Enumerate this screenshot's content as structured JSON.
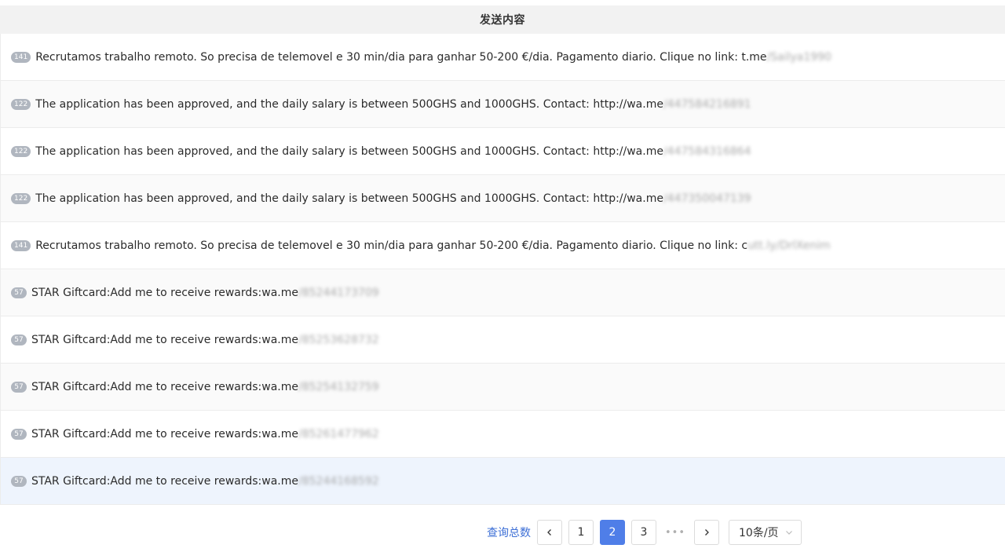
{
  "table": {
    "header": "发送内容",
    "rows": [
      {
        "badge": "141",
        "text": "Recrutamos trabalho remoto. So precisa de telemovel e 30 min/dia para ganhar 50-200 €/dia. Pagamento diario. Clique no link: t.me",
        "masked": "/Sailya1990"
      },
      {
        "badge": "122",
        "text": "The application has been approved, and the daily salary is between 500GHS and 1000GHS. Contact: http://wa.me",
        "masked": "/447584216891"
      },
      {
        "badge": "122",
        "text": "The application has been approved, and the daily salary is between 500GHS and 1000GHS. Contact: http://wa.me",
        "masked": "/447584316864"
      },
      {
        "badge": "122",
        "text": "The application has been approved, and the daily salary is between 500GHS and 1000GHS. Contact: http://wa.me",
        "masked": "/447350047139"
      },
      {
        "badge": "141",
        "text": "Recrutamos trabalho remoto. So precisa de telemovel e 30 min/dia para ganhar 50-200 €/dia. Pagamento diario. Clique no link: c",
        "masked": "utt.ly/DrlXenim"
      },
      {
        "badge": "57",
        "text": "STAR Giftcard:Add me to receive rewards:wa.me",
        "masked": "/85244173709"
      },
      {
        "badge": "57",
        "text": "STAR Giftcard:Add me to receive rewards:wa.me",
        "masked": "/85253628732"
      },
      {
        "badge": "57",
        "text": "STAR Giftcard:Add me to receive rewards:wa.me",
        "masked": "/85254132759"
      },
      {
        "badge": "57",
        "text": "STAR Giftcard:Add me to receive rewards:wa.me",
        "masked": "/85261477962"
      },
      {
        "badge": "57",
        "text": "STAR Giftcard:Add me to receive rewards:wa.me",
        "masked": "/85244168592"
      }
    ]
  },
  "pagination": {
    "total_label": "查询总数",
    "pages": [
      "1",
      "2",
      "3"
    ],
    "current_page": "2",
    "ellipsis": "•••",
    "page_size_label": "10条/页"
  },
  "colors": {
    "accent": "#4f7ee8",
    "badge": "#b0b6bf",
    "header_bg": "#f2f2f2",
    "hover_row": "#eef4fd"
  },
  "icons": {
    "prev": "chevron-left-icon",
    "next": "chevron-right-icon",
    "dropdown": "chevron-down-icon"
  }
}
